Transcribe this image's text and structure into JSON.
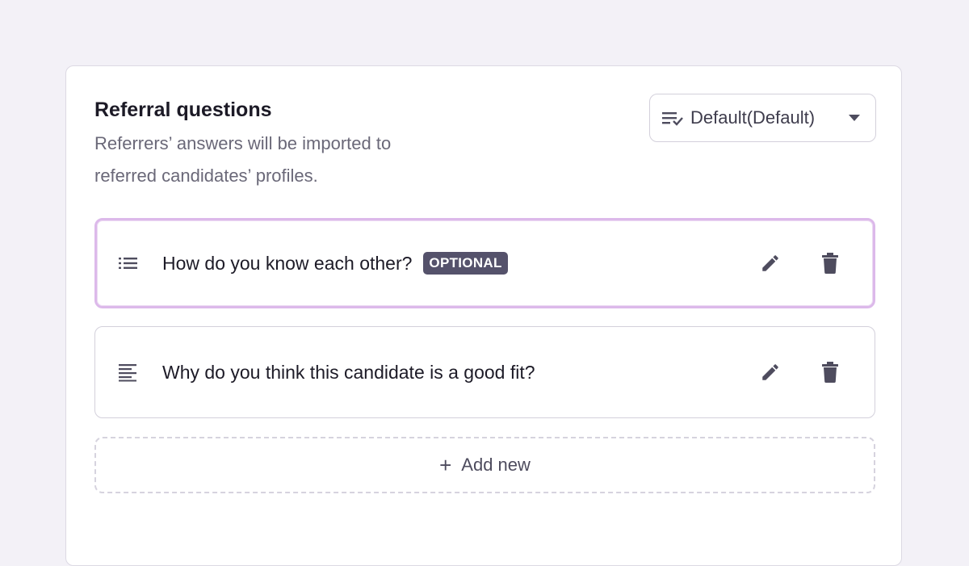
{
  "section": {
    "title": "Referral questions",
    "subtitle": "Referrers’ answers will be imported to referred candidates’ profiles."
  },
  "template_select": {
    "label": "Default(Default)",
    "icon": "checklist-icon",
    "caret_icon": "caret-down-icon"
  },
  "questions": [
    {
      "text": "How do you know each other?",
      "badge": "OPTIONAL",
      "type_icon": "list-icon",
      "selected": true
    },
    {
      "text": "Why do you think this candidate is a good fit?",
      "type_icon": "paragraph-icon",
      "selected": false
    }
  ],
  "add_new": {
    "icon": "+",
    "label": "Add new"
  },
  "colors": {
    "page_bg": "#f3f1f7",
    "selected_border": "#dcb9ea",
    "badge_bg": "#55526b",
    "icon_color": "#4e4c5e"
  }
}
